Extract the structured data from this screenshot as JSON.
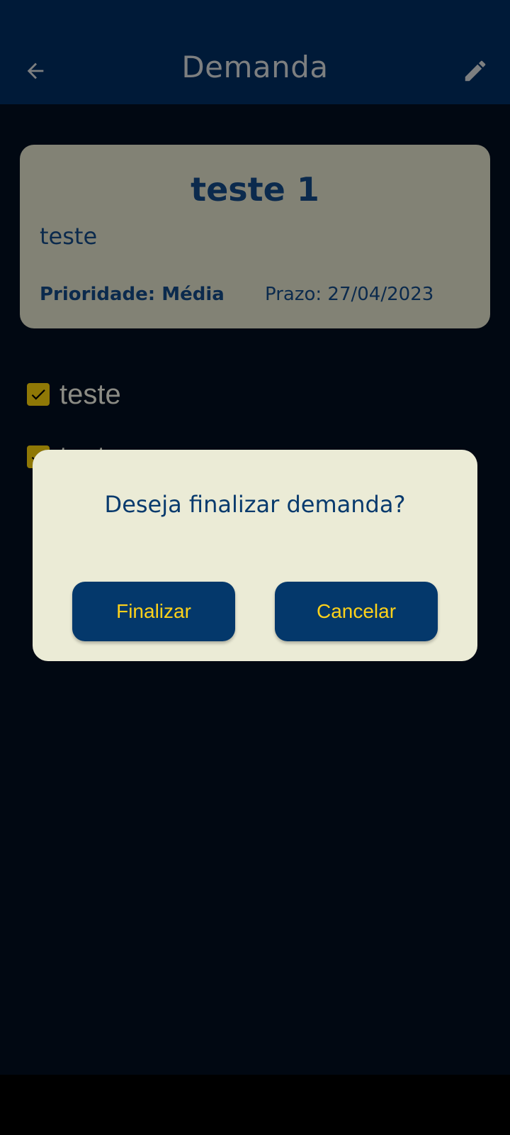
{
  "appbar": {
    "title": "Demanda",
    "back_icon": "arrow-left-icon",
    "edit_icon": "pencil-icon"
  },
  "card": {
    "title": "teste 1",
    "description": "teste",
    "priority": "Prioridade: Média",
    "deadline": "Prazo: 27/04/2023"
  },
  "tasks": [
    {
      "label": "teste",
      "checked": true
    },
    {
      "label": "teste",
      "checked": true
    }
  ],
  "dialog": {
    "question": "Deseja finalizar demanda?",
    "confirm_label": "Finalizar",
    "cancel_label": "Cancelar"
  },
  "colors": {
    "appbar_bg": "#001a38",
    "card_bg": "#828275",
    "dialog_bg": "#ebebd6",
    "button_bg": "#04386b",
    "button_text": "#ffd21a",
    "checkbox": "#8f7806"
  }
}
